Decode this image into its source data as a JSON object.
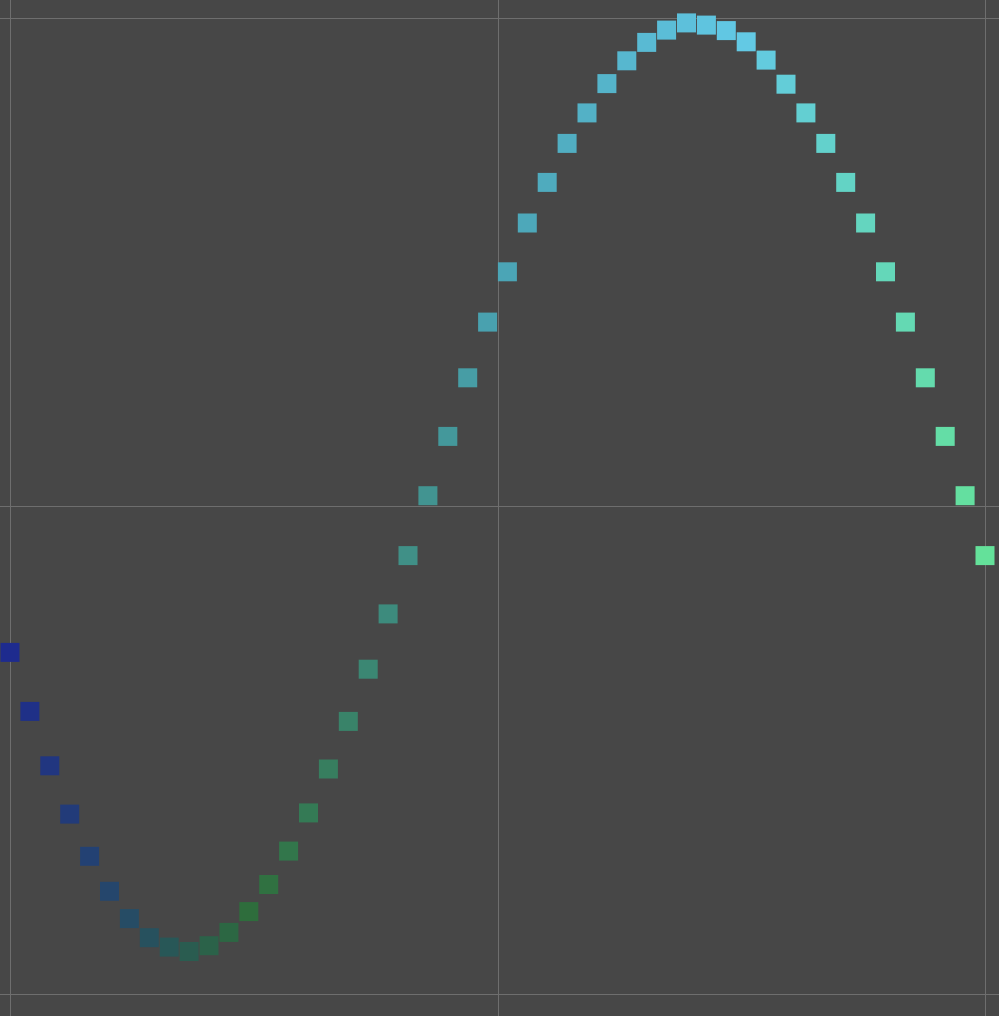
{
  "chart_data": {
    "type": "scatter",
    "title": "",
    "xlabel": "",
    "ylabel": "",
    "grid": true,
    "xlim": [
      0,
      6.2832
    ],
    "ylim": [
      -1,
      1
    ],
    "marker": "square",
    "colors": {
      "background": "#474747",
      "grid": "#6e6e6e",
      "gradient_start": "#1e2b8e",
      "gradient_q1": "#2e6e3a",
      "gradient_mid": "#4aa3b4",
      "gradient_q3": "#63c9e6",
      "gradient_end": "#64e19a"
    },
    "series": [
      {
        "x": [
          0.0,
          0.1282,
          0.2565,
          0.3847,
          0.5129,
          0.6411,
          0.7694,
          0.8976,
          1.0258,
          1.1541,
          1.2823,
          1.4105,
          1.5387,
          1.667,
          1.7952,
          1.9234,
          2.0517,
          2.1799,
          2.3081,
          2.4363,
          2.5646,
          2.6928,
          2.821,
          2.9493,
          3.0775,
          3.2057,
          3.3339,
          3.4622,
          3.5904,
          3.7186,
          3.8468,
          3.9751,
          4.1033,
          4.2315,
          4.3598,
          4.488,
          4.6162,
          4.7444,
          4.8727,
          5.0009,
          5.1291,
          5.2574,
          5.3856,
          5.5138,
          5.642,
          5.7703,
          5.8985,
          6.0267,
          6.155,
          6.2832
        ],
        "y": [
          -0.3,
          -0.421,
          -0.5323,
          -0.6314,
          -0.7179,
          -0.7896,
          -0.8455,
          -0.8847,
          -0.9038,
          -0.9129,
          -0.9011,
          -0.8738,
          -0.8311,
          -0.7757,
          -0.7072,
          -0.6288,
          -0.5389,
          -0.4414,
          -0.3345,
          -0.2211,
          -0.1017,
          0.0212,
          0.1426,
          0.2628,
          0.3768,
          0.48,
          0.58,
          0.6631,
          0.7431,
          0.8056,
          0.8655,
          0.9123,
          0.95,
          0.9753,
          0.99,
          0.9855,
          0.9742,
          0.9513,
          0.9137,
          0.8644,
          0.8056,
          0.7431,
          0.6631,
          0.58,
          0.48,
          0.3768,
          0.2628,
          0.1426,
          0.0212,
          -0.1017
        ]
      }
    ]
  }
}
